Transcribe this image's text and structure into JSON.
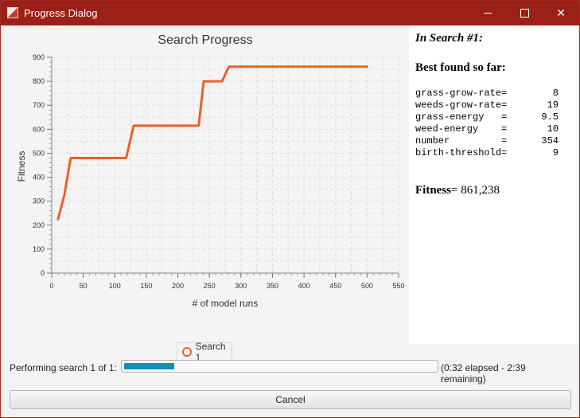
{
  "window": {
    "title": "Progress Dialog"
  },
  "chart_data": {
    "type": "line",
    "title": "Search Progress",
    "xlabel": "# of model runs",
    "ylabel": "Fitness",
    "xlim": [
      0,
      550
    ],
    "ylim": [
      0,
      900
    ],
    "x_ticks": [
      0,
      50,
      100,
      150,
      200,
      250,
      300,
      350,
      400,
      450,
      500,
      550
    ],
    "y_ticks": [
      0,
      100,
      200,
      300,
      400,
      500,
      600,
      700,
      800,
      900
    ],
    "grid": true,
    "legend": "bottom",
    "series": [
      {
        "name": "Search 1",
        "color": "#e8622c",
        "x": [
          10,
          20,
          30,
          118,
          130,
          233,
          241,
          270,
          281,
          500
        ],
        "y": [
          225,
          325,
          480,
          480,
          615,
          615,
          800,
          800,
          861,
          861
        ]
      }
    ]
  },
  "results": {
    "heading": "In Search #1:",
    "best_label": "Best found so far:",
    "params": [
      {
        "name": "grass-grow-rate=",
        "value": "8"
      },
      {
        "name": "weeds-grow-rate=",
        "value": "19"
      },
      {
        "name": "grass-energy   =",
        "value": "9.5"
      },
      {
        "name": "weed-energy    =",
        "value": "10"
      },
      {
        "name": "number         =",
        "value": "354"
      },
      {
        "name": "birth-threshold=",
        "value": "9"
      }
    ],
    "fitness_label": "Fitness",
    "fitness_value": "= 861,238"
  },
  "status": {
    "label": "Performing search 1 of 1:",
    "progress_fraction": 0.16,
    "elapsed": "(0:32 elapsed - 2:39 remaining)"
  },
  "buttons": {
    "cancel": "Cancel"
  }
}
